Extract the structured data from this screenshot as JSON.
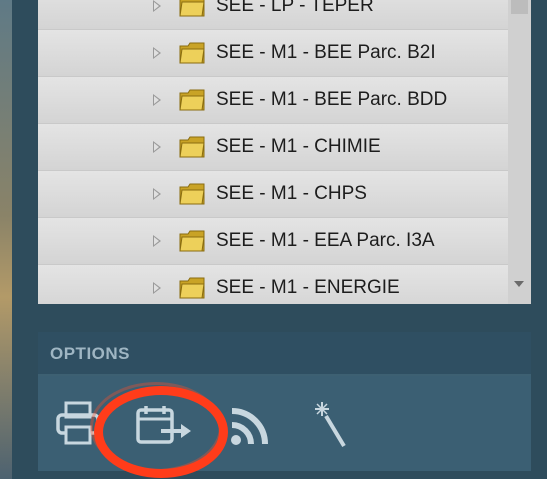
{
  "tree": {
    "items": [
      {
        "label": "SEE - LP - TEPER",
        "icon": "folder-icon"
      },
      {
        "label": "SEE - M1 - BEE Parc. B2I",
        "icon": "folder-icon"
      },
      {
        "label": "SEE - M1 - BEE Parc. BDD",
        "icon": "folder-icon"
      },
      {
        "label": "SEE - M1 - CHIMIE",
        "icon": "folder-icon"
      },
      {
        "label": "SEE - M1 - CHPS",
        "icon": "folder-icon"
      },
      {
        "label": "SEE - M1 - EEA Parc. I3A",
        "icon": "folder-icon"
      },
      {
        "label": "SEE - M1 - ENERGIE",
        "icon": "folder-icon"
      }
    ]
  },
  "options": {
    "title": "OPTIONS",
    "icons": [
      "print-icon",
      "calendar-export-icon",
      "rss-icon",
      "magic-wand-icon"
    ]
  },
  "colors": {
    "highlight": "#ff3c1a",
    "panel": "#2e4c5c",
    "folder": "#e6c23a"
  }
}
